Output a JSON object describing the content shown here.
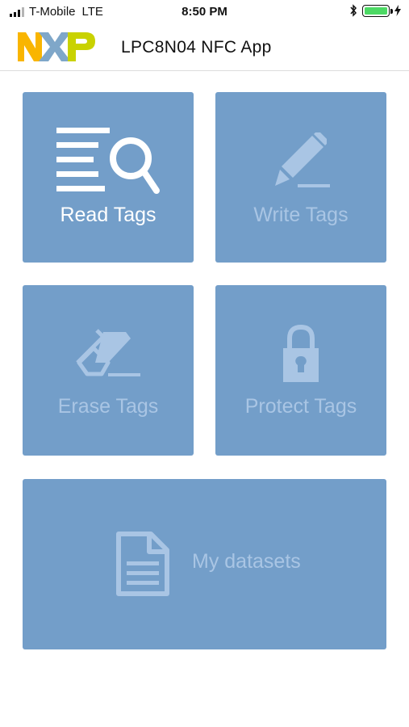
{
  "status_bar": {
    "carrier": "T-Mobile",
    "network": "LTE",
    "time": "8:50 PM"
  },
  "header": {
    "logo_text": "NXP",
    "title": "LPC8N04 NFC App"
  },
  "tiles": [
    {
      "id": "read",
      "label": "Read Tags",
      "icon": "read-tags-icon",
      "enabled": true
    },
    {
      "id": "write",
      "label": "Write Tags",
      "icon": "pencil-icon",
      "enabled": false
    },
    {
      "id": "erase",
      "label": "Erase Tags",
      "icon": "eraser-icon",
      "enabled": false
    },
    {
      "id": "protect",
      "label": "Protect Tags",
      "icon": "lock-icon",
      "enabled": false
    },
    {
      "id": "datasets",
      "label": "My datasets",
      "icon": "document-icon",
      "enabled": false
    }
  ],
  "colors": {
    "tile_background": "#739ec9",
    "active_text": "#ffffff",
    "inactive_text": "#a9c5e4",
    "battery": "#4cd964"
  }
}
